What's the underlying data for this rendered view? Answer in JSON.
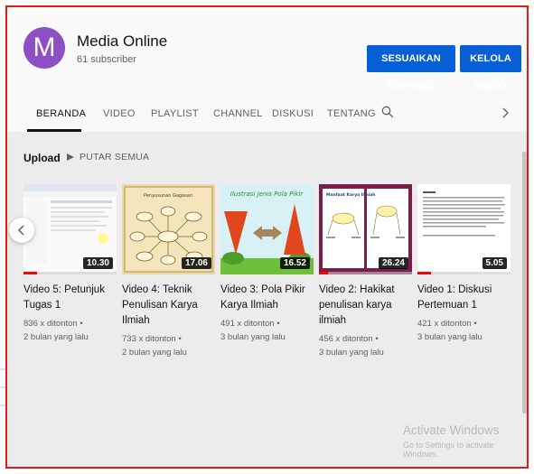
{
  "channel": {
    "avatar_letter": "M",
    "name": "Media Online",
    "subscribers": "61 subscriber",
    "avatar_color": "#8e4fc4"
  },
  "buttons": {
    "customize": "SESUAIKAN CHANNEL",
    "manage": "KELOLA VIDEO",
    "color": "#065fd4"
  },
  "tabs": [
    {
      "label": "BERANDA",
      "active": true
    },
    {
      "label": "VIDEO",
      "active": false
    },
    {
      "label": "PLAYLIST",
      "active": false
    },
    {
      "label": "CHANNEL",
      "active": false
    },
    {
      "label": "DISKUSI",
      "active": false
    },
    {
      "label": "TENTANG",
      "active": false
    }
  ],
  "section": {
    "title": "Upload",
    "play_all": "PUTAR SEMUA"
  },
  "videos": [
    {
      "title": "Video 5: Petunjuk Tugas 1",
      "views": "836 x ditonton •",
      "age": "2 bulan yang lalu",
      "duration": "10.30",
      "progress": 0.15,
      "thumb": "screenshot"
    },
    {
      "title": "Video 4: Teknik Penulisan Karya Ilmiah",
      "views": "733 x ditonton •",
      "age": "2 bulan yang lalu",
      "duration": "17.06",
      "progress": 0.0,
      "thumb": "mindmap",
      "thumb_text": "Penyusunan Gagasan"
    },
    {
      "title": "Video 3: Pola Pikir Karya Ilmiah",
      "views": "491 x ditonton •",
      "age": "3 bulan yang lalu",
      "duration": "16.52",
      "progress": 0.0,
      "thumb": "illustration",
      "thumb_text": "Ilustrasi Jenis Pola Pikir"
    },
    {
      "title": "Video 2: Hakikat penulisan karya ilmiah",
      "views": "456 x ditonton •",
      "age": "3 bulan yang lalu",
      "duration": "26.24",
      "progress": 0.1,
      "thumb": "book",
      "thumb_text": "Manfaat Karya Ilmiah"
    },
    {
      "title": "Video 1: Diskusi Pertemuan 1",
      "views": "421 x ditonton •",
      "age": "3 bulan yang lalu",
      "duration": "5.05",
      "progress": 0.15,
      "thumb": "document"
    }
  ],
  "watermark": {
    "line1": "Activate Windows",
    "line2": "Go to Settings to activate Windows."
  }
}
